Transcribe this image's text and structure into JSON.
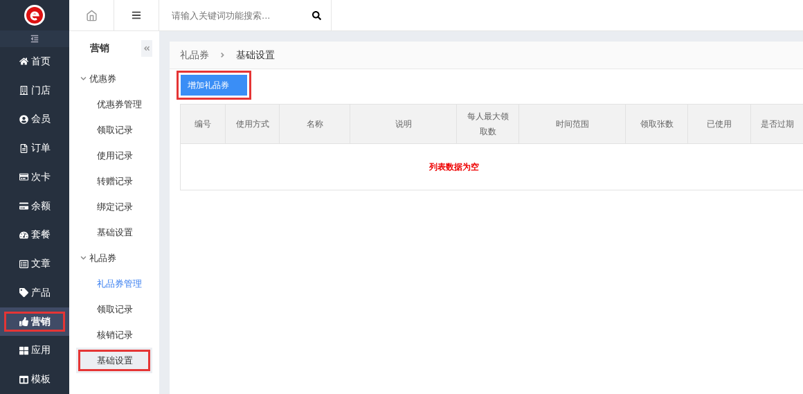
{
  "topbar": {
    "search": {
      "placeholder": "请输入关键词功能搜索..."
    }
  },
  "nav": {
    "items": [
      {
        "label": "首页",
        "selected": false,
        "highlighted": false
      },
      {
        "label": "门店",
        "selected": false,
        "highlighted": false
      },
      {
        "label": "会员",
        "selected": false,
        "highlighted": false
      },
      {
        "label": "订单",
        "selected": false,
        "highlighted": false
      },
      {
        "label": "次卡",
        "selected": false,
        "highlighted": false
      },
      {
        "label": "余额",
        "selected": false,
        "highlighted": false
      },
      {
        "label": "套餐",
        "selected": false,
        "highlighted": false
      },
      {
        "label": "文章",
        "selected": false,
        "highlighted": false
      },
      {
        "label": "产品",
        "selected": false,
        "highlighted": false
      },
      {
        "label": "营销",
        "selected": true,
        "highlighted": true
      },
      {
        "label": "应用",
        "selected": false,
        "highlighted": false
      },
      {
        "label": "模板",
        "selected": false,
        "highlighted": false
      }
    ]
  },
  "subnav": {
    "title": "营销",
    "groups": [
      {
        "label": "优惠券",
        "expanded": true,
        "items": [
          {
            "label": "优惠券管理",
            "selected": false,
            "highlighted": false
          },
          {
            "label": "领取记录",
            "selected": false,
            "highlighted": false
          },
          {
            "label": "使用记录",
            "selected": false,
            "highlighted": false
          },
          {
            "label": "转赠记录",
            "selected": false,
            "highlighted": false
          },
          {
            "label": "绑定记录",
            "selected": false,
            "highlighted": false
          },
          {
            "label": "基础设置",
            "selected": false,
            "highlighted": false
          }
        ]
      },
      {
        "label": "礼品券",
        "expanded": true,
        "items": [
          {
            "label": "礼品券管理",
            "selected": true,
            "highlighted": false
          },
          {
            "label": "领取记录",
            "selected": false,
            "highlighted": false
          },
          {
            "label": "核销记录",
            "selected": false,
            "highlighted": false
          },
          {
            "label": "基础设置",
            "selected": false,
            "highlighted": true
          }
        ]
      }
    ]
  },
  "breadcrumb": [
    "礼品券",
    "基础设置"
  ],
  "add_button": {
    "label": "增加礼品券",
    "highlighted": true
  },
  "table": {
    "columns": [
      "编号",
      "使用方式",
      "名称",
      "说明",
      "每人最大领取数",
      "时间范围",
      "领取张数",
      "已使用",
      "是否过期"
    ],
    "empty_text": "列表数据为空"
  }
}
